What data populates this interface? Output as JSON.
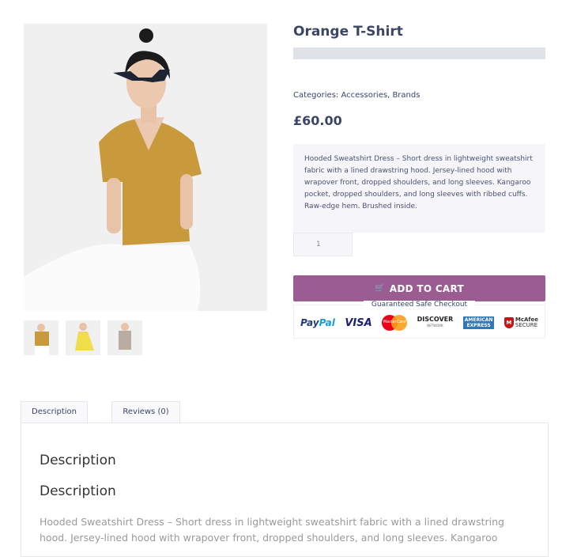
{
  "product": {
    "title": "Orange T-Shirt",
    "categories_label": "Categories:",
    "categories": [
      "Accessories",
      "Brands"
    ],
    "price": "£60.00",
    "short_description": "Hooded Sweatshirt Dress – Short dress in lightweight sweatshirt fabric with a lined drawstring hood. Jersey-lined hood with wrapover front, dropped shoulders, and long sleeves. Kangaroo pocket, dropped shoulders, and long sleeves with ribbed cuffs. Raw-edge hem. Brushed inside.",
    "quantity": "1",
    "add_to_cart_label": "ADD TO CART",
    "add_to_cart_icon": "cart-icon",
    "safe_checkout_label": "Guaranteed Safe Checkout",
    "payment_methods": [
      "PayPal",
      "VISA",
      "MasterCard",
      "DISCOVER",
      "AMERICAN EXPRESS",
      "McAfee SECURE"
    ],
    "gallery": {
      "main_image": "woman in orange t-shirt and white trousers",
      "thumbnails": [
        "orange t-shirt",
        "yellow dress",
        "grey sequin top"
      ]
    }
  },
  "tabs": [
    {
      "label": "Description",
      "active": true
    },
    {
      "label": "Reviews (0)",
      "active": false
    }
  ],
  "panel": {
    "heading_1": "Description",
    "heading_2": "Description",
    "body": "Hooded Sweatshirt Dress – Short dress in lightweight sweatshirt fabric with a lined drawstring hood. Jersey-lined hood with wrapover front, dropped shoulders, and long sleeves. Kangaroo"
  },
  "colors": {
    "accent": "#9a5c91",
    "text": "#3b4566",
    "rating_placeholder": "#dfe2e6",
    "desc_bg": "#f5f5fa"
  }
}
